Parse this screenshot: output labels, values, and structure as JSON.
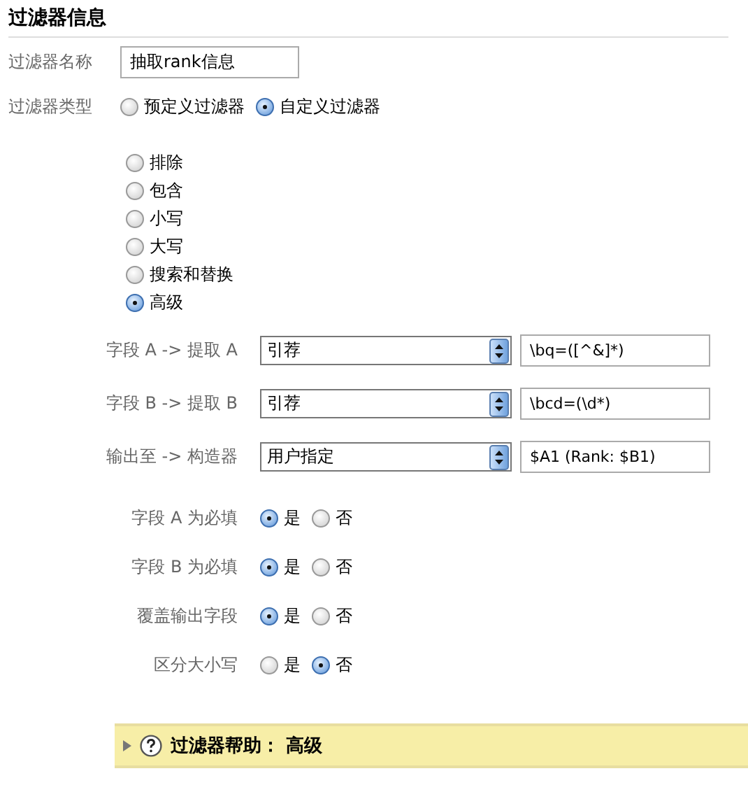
{
  "title": "过滤器信息",
  "name_field": {
    "label": "过滤器名称",
    "value": "抽取rank信息"
  },
  "type_field": {
    "label": "过滤器类型",
    "options": [
      {
        "label": "预定义过滤器",
        "selected": false
      },
      {
        "label": "自定义过滤器",
        "selected": true
      }
    ]
  },
  "filter_options": [
    {
      "label": "排除",
      "selected": false
    },
    {
      "label": "包含",
      "selected": false
    },
    {
      "label": "小写",
      "selected": false
    },
    {
      "label": "大写",
      "selected": false
    },
    {
      "label": "搜索和替换",
      "selected": false
    },
    {
      "label": "高级",
      "selected": true
    }
  ],
  "field_rows": [
    {
      "label": "字段 A -> 提取 A",
      "select": "引荐",
      "value": "\\bq=([^&]*)"
    },
    {
      "label": "字段 B -> 提取 B",
      "select": "引荐",
      "value": "\\bcd=(\\d*)"
    },
    {
      "label": "输出至 -> 构造器",
      "select": "用户指定",
      "value": "$A1 (Rank: $B1)"
    }
  ],
  "yes_no_rows": [
    {
      "label": "字段 A 为必填",
      "options": [
        {
          "label": "是",
          "selected": true
        },
        {
          "label": "否",
          "selected": false
        }
      ]
    },
    {
      "label": "字段 B 为必填",
      "options": [
        {
          "label": "是",
          "selected": true
        },
        {
          "label": "否",
          "selected": false
        }
      ]
    },
    {
      "label": "覆盖输出字段",
      "options": [
        {
          "label": "是",
          "selected": true
        },
        {
          "label": "否",
          "selected": false
        }
      ]
    },
    {
      "label": "区分大小写",
      "options": [
        {
          "label": "是",
          "selected": false
        },
        {
          "label": "否",
          "selected": true
        }
      ]
    }
  ],
  "help_bar": {
    "expanded": false,
    "label": "过滤器帮助： 高级"
  }
}
